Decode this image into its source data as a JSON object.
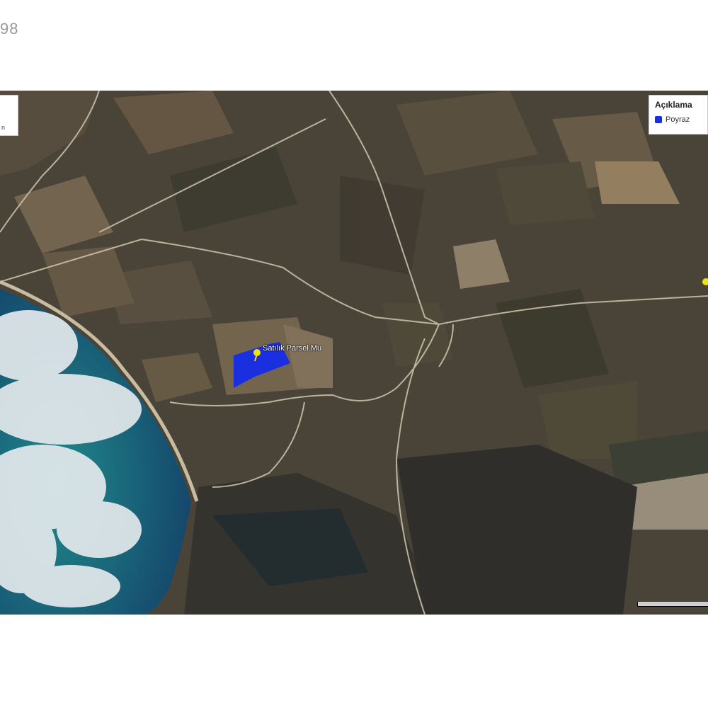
{
  "header": {
    "number_fragment": "98"
  },
  "legend": {
    "title": "Açıklama",
    "items": [
      {
        "label": "Poyraz",
        "color": "#1a2fe0"
      }
    ]
  },
  "left_control": {
    "text": "n"
  },
  "parcel": {
    "label": "Satılık Parsel Mu",
    "fill": "#1a2fe0",
    "marker_color": "#f2e400"
  },
  "colors": {
    "sea_shallow": "#1f8a8a",
    "sea_deep": "#164f74",
    "land": "#4a4438",
    "road": "#c9bfa8"
  }
}
